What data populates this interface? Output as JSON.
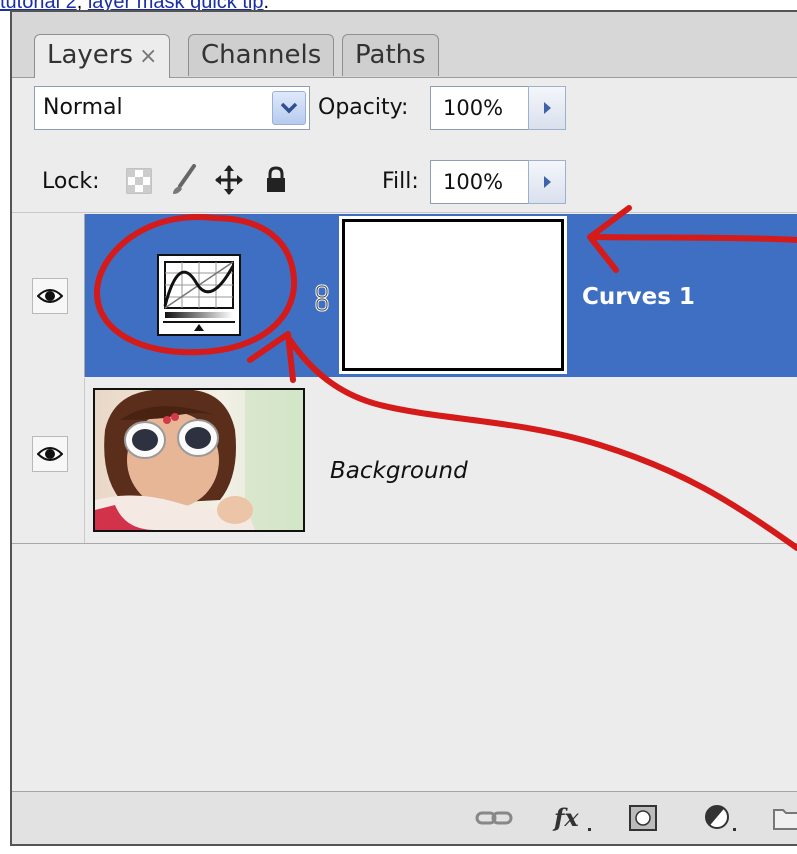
{
  "header_links": {
    "link1": "tutorial 2",
    "separator": ",",
    "link2": "layer mask quick tip",
    "trailing": "."
  },
  "tabs": [
    {
      "label": "Layers",
      "close": "×"
    },
    {
      "label": "Channels"
    },
    {
      "label": "Paths"
    }
  ],
  "blend_mode": {
    "value": "Normal"
  },
  "opacity": {
    "label": "Opacity:",
    "value": "100%"
  },
  "lock": {
    "label": "Lock:"
  },
  "fill": {
    "label": "Fill:",
    "value": "100%"
  },
  "layers": [
    {
      "name": "Curves 1",
      "type": "adjustment",
      "selected": true,
      "visible": true
    },
    {
      "name": "Background",
      "type": "image",
      "selected": false,
      "visible": true
    }
  ],
  "colors": {
    "selection": "#3f6fc3",
    "annotation": "#d51a1a",
    "link": "#1a2ea8"
  },
  "icons": [
    "eye-icon",
    "chevron-down-icon",
    "arrow-right-icon",
    "lock-transparent-icon",
    "lock-brush-icon",
    "lock-move-icon",
    "lock-all-icon",
    "chain-link-icon",
    "curves-icon",
    "link-layers-icon",
    "fx-icon",
    "add-mask-icon",
    "adjustment-layer-icon",
    "new-group-icon"
  ]
}
